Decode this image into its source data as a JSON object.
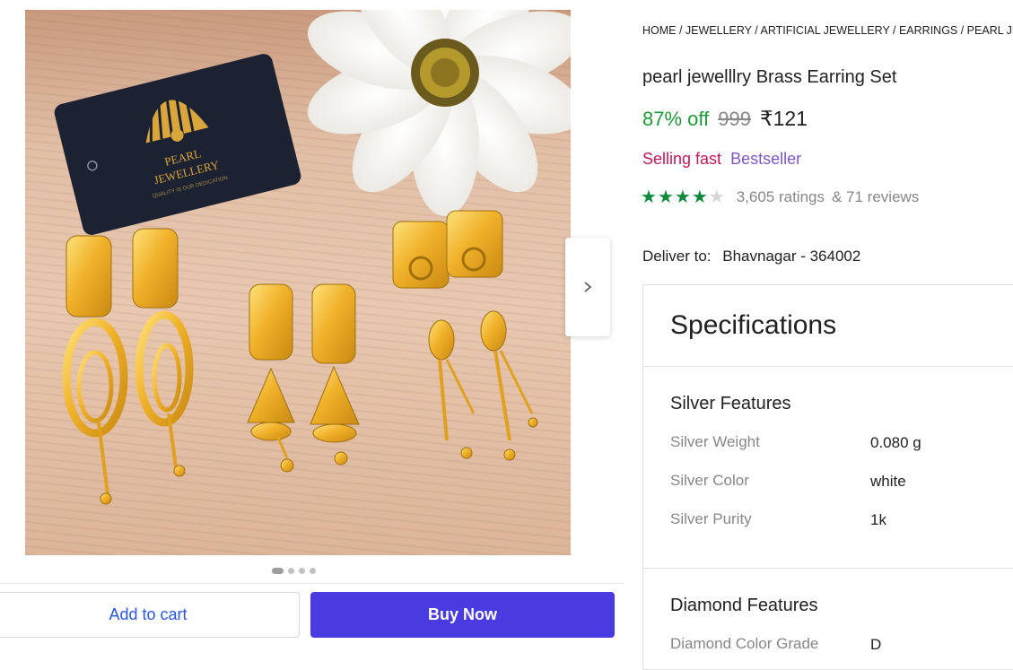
{
  "breadcrumb": "HOME / JEWELLERY / ARTIFICIAL JEWELLERY / EARRINGS / PEARL JE",
  "product": {
    "title": "pearl jewelllry Brass Earring Set",
    "discount": "87% off",
    "mrp": "999",
    "price": "₹121",
    "tag_selling": "Selling fast",
    "tag_bestseller": "Bestseller",
    "rating": 4,
    "rating_max": 5,
    "ratings_text": "3,605 ratings",
    "reviews_text": "& 71 reviews"
  },
  "image": {
    "card_brand": "PEARL",
    "card_brand2": "JEWELLERY",
    "card_tagline": "QUALITY IS OUR DEDICATION",
    "total_images": 4,
    "active_image": 1
  },
  "delivery": {
    "label": "Deliver to:",
    "location": "Bhavnagar - 364002"
  },
  "buttons": {
    "add_to_cart": "Add to cart",
    "buy_now": "Buy Now"
  },
  "specifications": {
    "title": "Specifications",
    "silver_section": "Silver Features",
    "silver": [
      {
        "key": "Silver Weight",
        "value": "0.080 g"
      },
      {
        "key": "Silver Color",
        "value": "white"
      },
      {
        "key": "Silver Purity",
        "value": "1k"
      }
    ],
    "diamond_section": "Diamond Features",
    "diamond": [
      {
        "key": "Diamond Color Grade",
        "value": "D"
      }
    ]
  },
  "colors": {
    "discount_green": "#1f9a3a",
    "buy_now_bg": "#4a3be0",
    "add_to_cart_text": "#2a55e5",
    "rating_star": "#0f8a3c",
    "selling_fast": "#c2185b",
    "bestseller": "#7e57c2"
  }
}
